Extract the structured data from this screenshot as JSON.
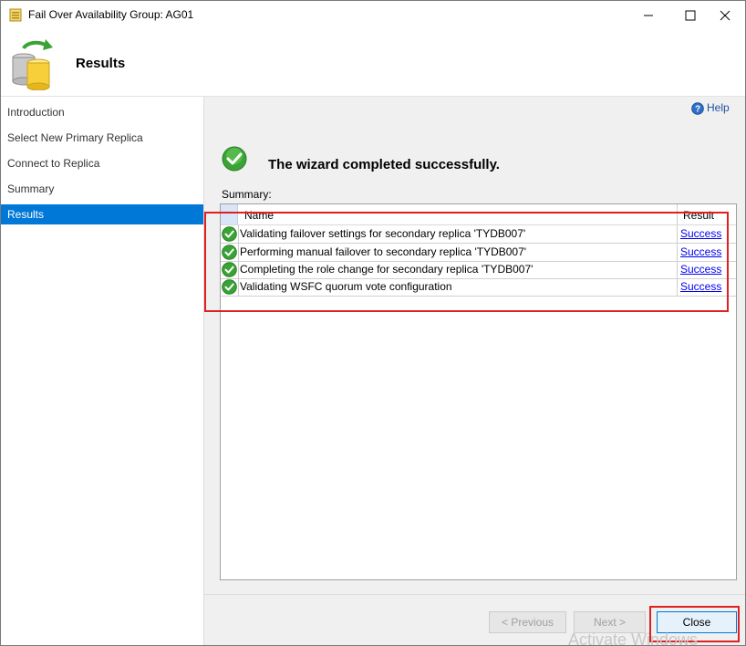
{
  "window": {
    "title": "Fail Over Availability Group: AG01",
    "controls": {
      "minimize": "minimize",
      "maximize": "maximize",
      "close": "close"
    }
  },
  "header": {
    "title": "Results",
    "icon": "database-sync-icon"
  },
  "nav": {
    "items": [
      {
        "label": "Introduction",
        "active": false
      },
      {
        "label": "Select New Primary Replica",
        "active": false
      },
      {
        "label": "Connect to Replica",
        "active": false
      },
      {
        "label": "Summary",
        "active": false
      },
      {
        "label": "Results",
        "active": true
      }
    ]
  },
  "help": {
    "label": "Help"
  },
  "status": {
    "message": "The wizard completed successfully."
  },
  "summary": {
    "label": "Summary:",
    "columns": {
      "name": "Name",
      "result": "Result"
    },
    "rows": [
      {
        "name": "Validating failover settings for secondary replica 'TYDB007'",
        "result": "Success"
      },
      {
        "name": "Performing manual failover to secondary replica 'TYDB007'",
        "result": "Success"
      },
      {
        "name": "Completing the role change for secondary replica 'TYDB007'",
        "result": "Success"
      },
      {
        "name": "Validating WSFC quorum vote configuration",
        "result": "Success"
      }
    ]
  },
  "buttons": {
    "previous": "< Previous",
    "next": "Next >",
    "close": "Close"
  },
  "watermark": "Activate Windows",
  "colors": {
    "accent": "#0078d7",
    "success_green": "#3aa335",
    "annotation_red": "#e02020",
    "link": "#0000ee"
  }
}
